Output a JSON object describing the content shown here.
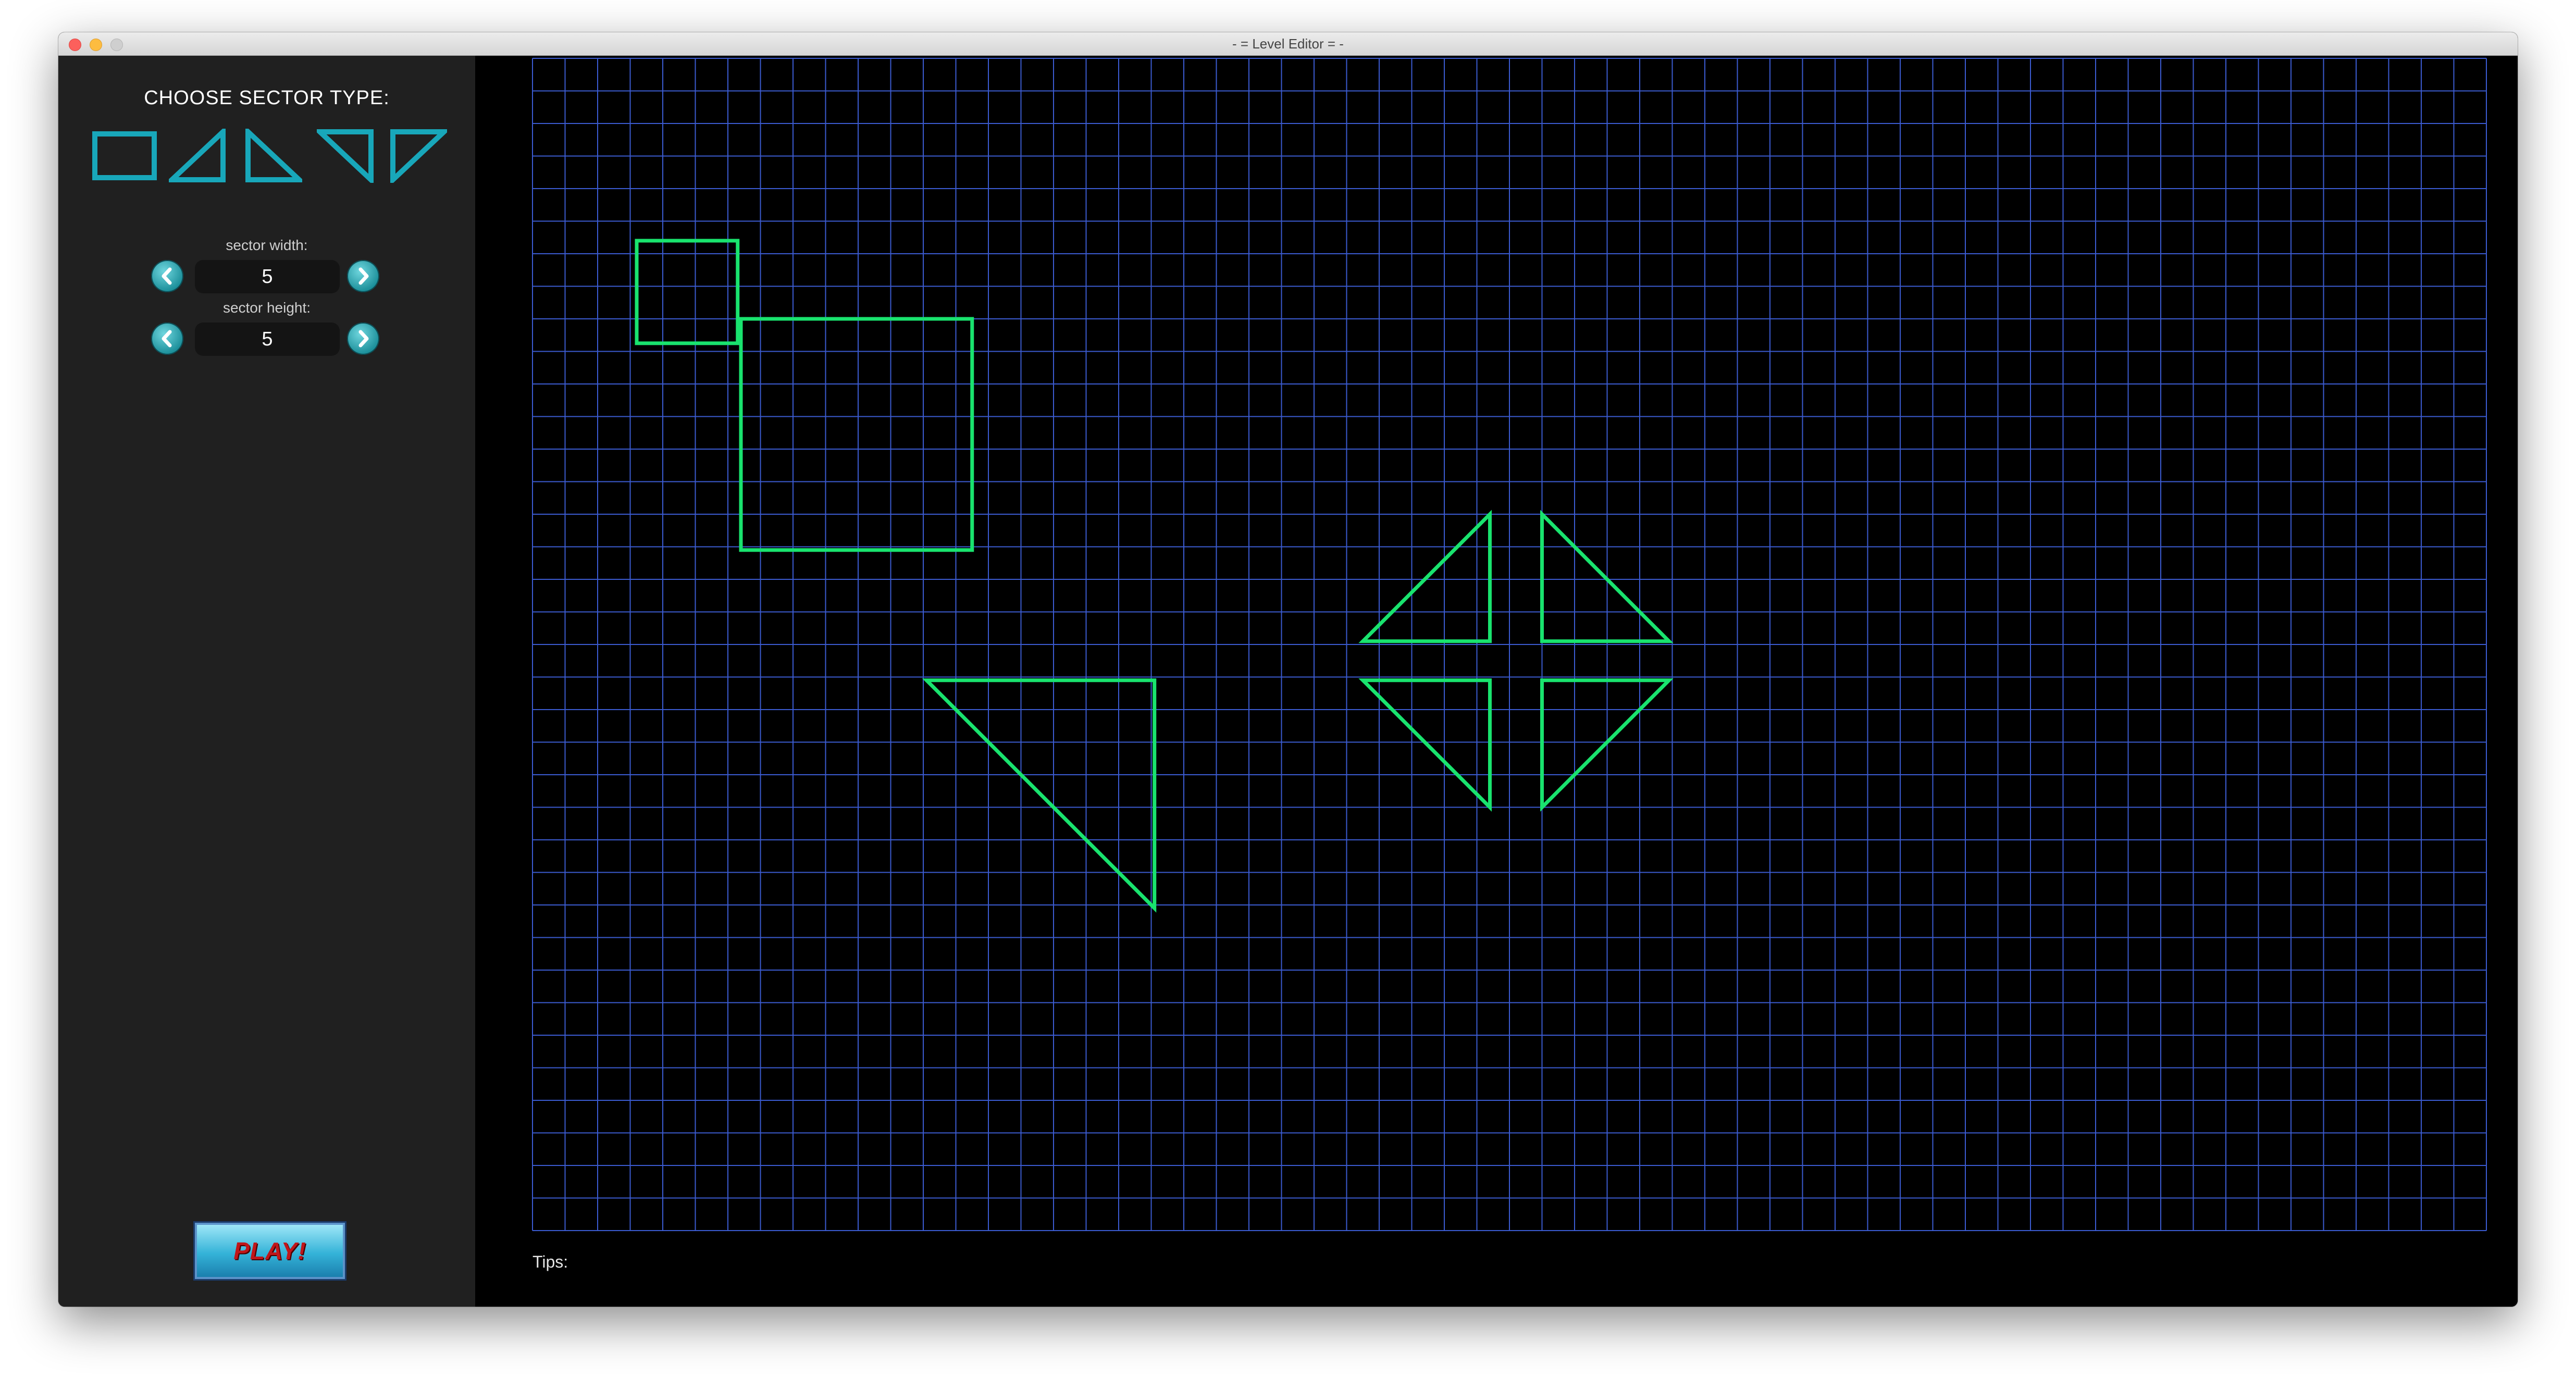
{
  "window": {
    "title": "- = Level Editor = -"
  },
  "sidebar": {
    "heading": "CHOOSE SECTOR TYPE:",
    "shapes": [
      "rectangle-icon",
      "right-triangle-bottom-right-icon",
      "right-triangle-bottom-left-icon",
      "right-triangle-top-right-icon",
      "right-triangle-top-left-icon"
    ],
    "sector_width": {
      "label": "sector width:",
      "value": "5"
    },
    "sector_height": {
      "label": "sector height:",
      "value": "5"
    },
    "play_label": "PLAY!"
  },
  "editor": {
    "tips_label": "Tips:",
    "grid_columns": 60,
    "grid_rows": 36,
    "colors": {
      "grid_line": "#3b5bd1",
      "sector_outline": "#19e36e",
      "accent": "#18a7ba"
    }
  }
}
